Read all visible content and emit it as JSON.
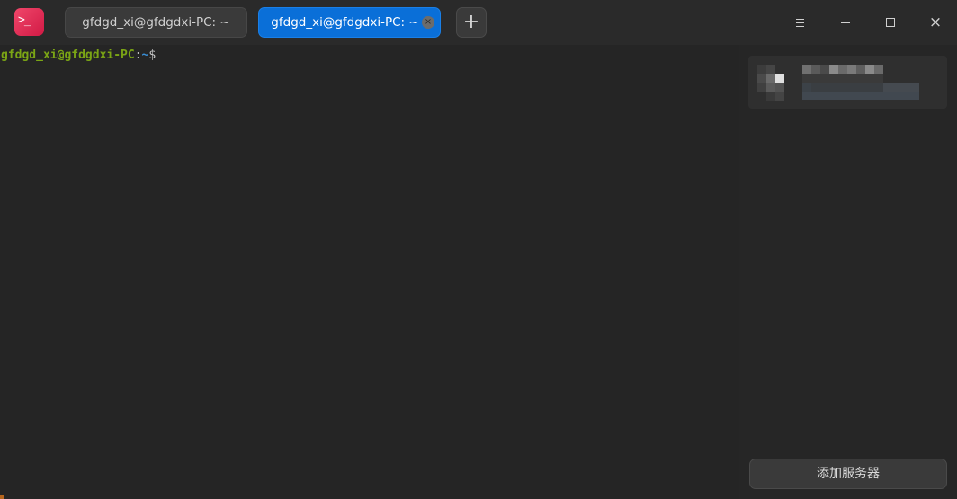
{
  "titlebar": {
    "app_icon": "terminal-icon",
    "app_icon_glyph": ">_",
    "tabs": [
      {
        "label": "gfdgd_xi@gfdgdxi-PC: ~",
        "active": false
      },
      {
        "label": "gfdgd_xi@gfdgdxi-PC: ~",
        "active": true,
        "close_glyph": "×"
      }
    ],
    "new_tab_glyph": "+",
    "window_controls": {
      "menu": "menu-icon",
      "minimize": "minimize-icon",
      "maximize": "maximize-icon",
      "close": "close-icon",
      "close_glyph": "×"
    }
  },
  "terminal": {
    "prompt_user": "gfdgd_xi@gfdgdxi-PC",
    "prompt_sep": ":",
    "prompt_path": "~",
    "prompt_symbol": "$"
  },
  "panel": {
    "server_item": {
      "blurred": true
    },
    "add_server_label": "添加服务器"
  },
  "colors": {
    "background": "#252525",
    "active_tab": "#0a6fd8",
    "prompt_user": "#7ba515",
    "prompt_path": "#3a8fd6",
    "app_icon": "#e23a5c"
  }
}
